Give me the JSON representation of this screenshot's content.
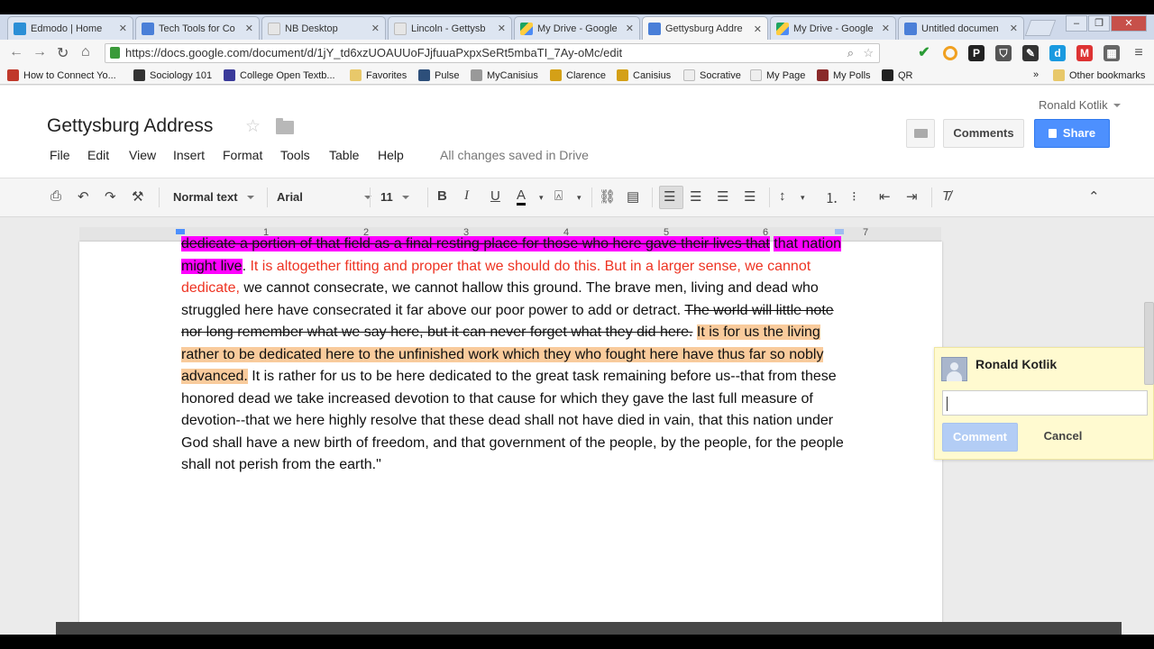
{
  "tabs": [
    {
      "label": "Edmodo | Home"
    },
    {
      "label": "Tech Tools for Co"
    },
    {
      "label": "NB Desktop"
    },
    {
      "label": "Lincoln - Gettysb"
    },
    {
      "label": "My Drive - Google"
    },
    {
      "label": "Gettysburg Addre"
    },
    {
      "label": "My Drive - Google"
    },
    {
      "label": "Untitled documen"
    }
  ],
  "address_bar": {
    "url": "https://docs.google.com/document/d/1jY_td6xzUOAUUoFJjfuuaPxpxSeRt5mbaTI_7Ay-oMc/edit"
  },
  "bookmarks": [
    {
      "label": "How to Connect Yo..."
    },
    {
      "label": "Sociology 101"
    },
    {
      "label": "College Open Textb..."
    },
    {
      "label": "Favorites"
    },
    {
      "label": "Pulse"
    },
    {
      "label": "MyCanisius"
    },
    {
      "label": "Clarence"
    },
    {
      "label": "Canisius"
    },
    {
      "label": "Socrative"
    },
    {
      "label": "My Page"
    },
    {
      "label": "My Polls"
    },
    {
      "label": "QR"
    }
  ],
  "bookmarks_overflow": "»",
  "other_bookmarks": "Other bookmarks",
  "doc": {
    "title": "Gettysburg Address",
    "menu": [
      "File",
      "Edit",
      "View",
      "Insert",
      "Format",
      "Tools",
      "Table",
      "Help"
    ],
    "save_status": "All changes saved in Drive",
    "user": "Ronald Kotlik",
    "comments_label": "Comments",
    "share_label": "Share"
  },
  "toolbar": {
    "style": "Normal text",
    "font": "Arial",
    "size": "11"
  },
  "ruler": [
    "1",
    "2",
    "3",
    "4",
    "5",
    "6",
    "7"
  ],
  "text": {
    "line0": "dedicate a portion of that field as a final resting place for those who here gave their lives that",
    "seg_pink": "that nation might live",
    "seg_after_pink": ". ",
    "seg_red": "It is altogether fitting and proper that we should do this. But in a larger sense, we cannot dedicate,",
    "seg_black1": " we cannot consecrate, we cannot hallow this ground. The brave men, living and dead who struggled here have consecrated it far above our poor power to add or detract. ",
    "seg_strike": "The world will little note nor long remember what we say here, but it can never forget what they did here.",
    "seg_space": " ",
    "seg_orange": "It is for us the living rather to be dedicated here to the unfinished work which they who fought here have thus far so nobly advanced.",
    "seg_black2": " It is rather for us to be here dedicated to the great task remaining before us--that from these honored dead we take increased devotion to that cause for which they gave the last full measure of devotion--that we here highly resolve that these dead shall not have died in vain, that this nation under God shall have a new birth of freedom, and that government of the people, by the people, for the people shall not perish from the earth.\""
  },
  "comment_box": {
    "name": "Ronald Kotlik",
    "input_value": "",
    "comment_label": "Comment",
    "cancel_label": "Cancel"
  }
}
